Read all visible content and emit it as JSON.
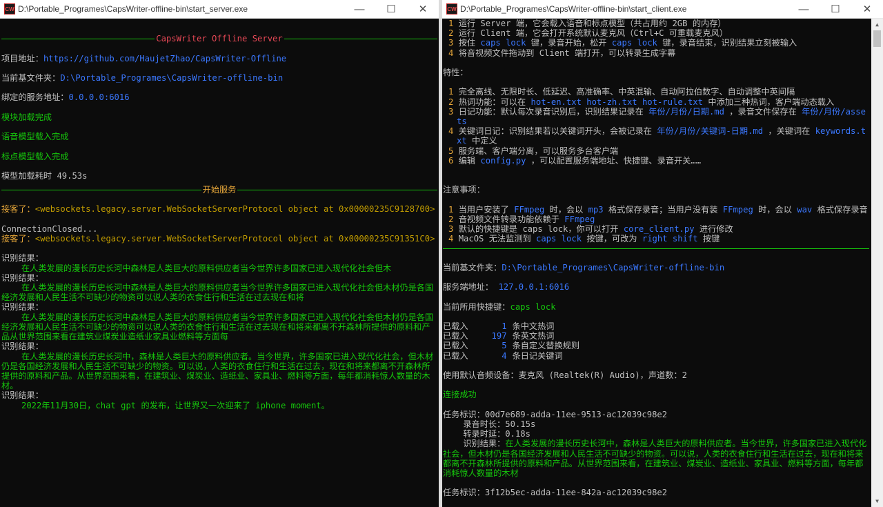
{
  "left_window": {
    "title": "D:\\Portable_Programes\\CapsWriter-offline-bin\\start_server.exe",
    "header_title": "CapsWriter Offline Server",
    "project_label": "项目地址：",
    "project_url": "https://github.com/HaujetZhao/CapsWriter-Offline",
    "dir_label": "当前基文件夹：",
    "dir_value": "D:\\Portable_Programes\\CapsWriter-offline-bin",
    "bind_label": "绑定的服务地址：",
    "bind_value": "0.0.0.0:6016",
    "module_loaded": "模块加载完成",
    "speech_loaded": "语音模型载入完成",
    "punc_loaded": "标点模型载入完成",
    "load_time": "模型加载耗时 49.53s",
    "start_service": "开始服务",
    "guest1_prefix": "接客了：",
    "guest1_obj": "<websockets.legacy.server.WebSocketServerProtocol object at 0x00000235C9128700>",
    "closed": "ConnectionClosed...",
    "guest2_prefix": "接客了：",
    "guest2_obj": "<websockets.legacy.server.WebSocketServerProtocol object at 0x00000235C91351C0>",
    "result_label": "识别结果：",
    "results": [
      "在人类发展的漫长历史长河中森林是人类巨大的原料供应者当今世界许多国家已进入现代化社会但木",
      "在人类发展的漫长历史长河中森林是人类巨大的原料供应者当今世界许多国家已进入现代化社会但木材仍是各国经济发展和人民生活不可缺少的物资可以说人类的衣食住行和生活在过去现在和将",
      "在人类发展的漫长历史长河中森林是人类巨大的原料供应者当今世界许多国家已进入现代化社会但木材仍是各国经济发展和人民生活不可缺少的物资可以说人类的衣食住行和生活在过去现在和将来都离不开森林所提供的原料和产品从世界范围来看在建筑业煤炭业造纸业家具业燃料等方面每",
      "在人类发展的漫长历史长河中，森林是人类巨大的原料供应者。当今世界，许多国家已进入现代化社会，但木材仍是各国经济发展和人民生活不可缺少的物资。可以说，人类的衣食住行和生活在过去，现在和将来都离不开森林所提供的原料和产品。从世界范围来看，在建筑业、煤炭业、造纸业、家具业、燃料等方面，每年都消耗惊人数量的木材。",
      "2022年11月30日，chat gpt 的发布，让世界又一次迎来了 iphone moment。"
    ]
  },
  "right_window": {
    "title": "D:\\Portable_Programes\\CapsWriter-offline-bin\\start_client.exe",
    "steps": [
      {
        "n": "1",
        "parts": [
          [
            "n",
            "运行 Server 端，它会载入语音和标点模型（共占用约 2GB 的内存）"
          ]
        ]
      },
      {
        "n": "2",
        "parts": [
          [
            "n",
            "运行 Client 端，它会打开系统默认麦克风（Ctrl+C 可重载麦克风）"
          ]
        ]
      },
      {
        "n": "3",
        "parts": [
          [
            "n",
            "按住 "
          ],
          [
            "b",
            "caps lock"
          ],
          [
            "n",
            " 键，录音开始，松开 "
          ],
          [
            "b",
            "caps lock"
          ],
          [
            "n",
            " 键，录音结束，识别结果立刻被输入"
          ]
        ]
      },
      {
        "n": "4",
        "parts": [
          [
            "n",
            "将音视频文件拖动到 Client 端打开，可以转录生成字幕"
          ]
        ]
      }
    ],
    "features_title": "特性：",
    "features": [
      {
        "n": "1",
        "parts": [
          [
            "n",
            "完全离线、无限时长、低延迟、高准确率、中英混输、自动阿拉伯数字、自动调整中英间隔"
          ]
        ]
      },
      {
        "n": "2",
        "parts": [
          [
            "n",
            "热词功能：可以在 "
          ],
          [
            "b",
            "hot-en.txt hot-zh.txt hot-rule.txt"
          ],
          [
            "n",
            " 中添加三种热词，客户端动态载入"
          ]
        ]
      },
      {
        "n": "3",
        "parts": [
          [
            "n",
            "日记功能：默认每次录音识别后，识别结果记录在 "
          ],
          [
            "b",
            "年份/月份/日期.md"
          ],
          [
            "n",
            " ，录音文件保存在 "
          ],
          [
            "b",
            "年份/月份/assets"
          ]
        ]
      },
      {
        "n": "4",
        "parts": [
          [
            "n",
            "关键词日记：识别结果若以关键词开头，会被记录在 "
          ],
          [
            "b",
            "年份/月份/关键词-日期.md"
          ],
          [
            "n",
            " ，关键词在 "
          ],
          [
            "b",
            "keywords.txt"
          ],
          [
            "n",
            " 中定义"
          ]
        ]
      },
      {
        "n": "5",
        "parts": [
          [
            "n",
            "服务端、客户端分离，可以服务多台客户端"
          ]
        ]
      },
      {
        "n": "6",
        "parts": [
          [
            "n",
            "编辑 "
          ],
          [
            "b",
            "config.py"
          ],
          [
            "n",
            " ，可以配置服务端地址、快捷键、录音开关……"
          ]
        ]
      }
    ],
    "notes_title": "注意事项：",
    "notes": [
      {
        "n": "1",
        "parts": [
          [
            "n",
            "当用户安装了 "
          ],
          [
            "b",
            "FFmpeg"
          ],
          [
            "n",
            " 时，会以 "
          ],
          [
            "b",
            "mp3"
          ],
          [
            "n",
            " 格式保存录音；当用户没有装 "
          ],
          [
            "b",
            "FFmpeg"
          ],
          [
            "n",
            " 时，会以 "
          ],
          [
            "b",
            "wav"
          ],
          [
            "n",
            " 格式保存录音"
          ]
        ]
      },
      {
        "n": "2",
        "parts": [
          [
            "n",
            "音视频文件转录功能依赖于 "
          ],
          [
            "b",
            "FFmpeg"
          ]
        ]
      },
      {
        "n": "3",
        "parts": [
          [
            "n",
            "默认的快捷键是 caps lock，你可以打开 "
          ],
          [
            "b",
            "core_client.py"
          ],
          [
            "n",
            " 进行修改"
          ]
        ]
      },
      {
        "n": "4",
        "parts": [
          [
            "n",
            "MacOS 无法监测到 "
          ],
          [
            "b",
            "caps lock"
          ],
          [
            "n",
            " 按键，可改为 "
          ],
          [
            "b",
            "right shift"
          ],
          [
            "n",
            " 按键"
          ]
        ]
      }
    ],
    "dir_label": "当前基文件夹：",
    "dir_value": "D:\\Portable_Programes\\CapsWriter-offline-bin",
    "server_label": "服务端地址：",
    "server_value": " 127.0.0.1:6016",
    "hotkey_label": "当前所用快捷键：",
    "hotkey_value": "caps lock",
    "loaded": [
      {
        "label": "已载入",
        "count": "1",
        "text": "条中文热词"
      },
      {
        "label": "已载入",
        "count": "197",
        "text": "条英文热词"
      },
      {
        "label": "已载入",
        "count": "5",
        "text": "条自定义替换规则"
      },
      {
        "label": "已载入",
        "count": "4",
        "text": "条日记关键词"
      }
    ],
    "audio_device": "使用默认音频设备：麦克风 (Realtek(R) Audio)，声道数：2",
    "connected": "连接成功",
    "task1_id": "任务标识：00d7e689-adda-11ee-9513-ac12039c98e2",
    "task1_duration": "    录音时长：50.15s",
    "task1_delay": "    转录时延：0.18s",
    "task1_result_label": "    识别结果：",
    "task1_result": "在人类发展的漫长历史长河中，森林是人类巨大的原料供应者。当今世界，许多国家已进入现代化社会，但木材仍是各国经济发展和人民生活不可缺少的物资。可以说，人类的衣食住行和生活在过去，现在和将来都离不开森林所提供的原料和产品。从世界范围来看，在建筑业、煤炭业、造纸业、家具业、燃料等方面，每年都消耗惊人数量的木材",
    "task2_id": "任务标识：3f12b5ec-adda-11ee-842a-ac12039c98e2"
  },
  "window_controls": {
    "minimize": "—",
    "maximize": "☐",
    "close": "✕"
  },
  "app_icon_text": "CW"
}
